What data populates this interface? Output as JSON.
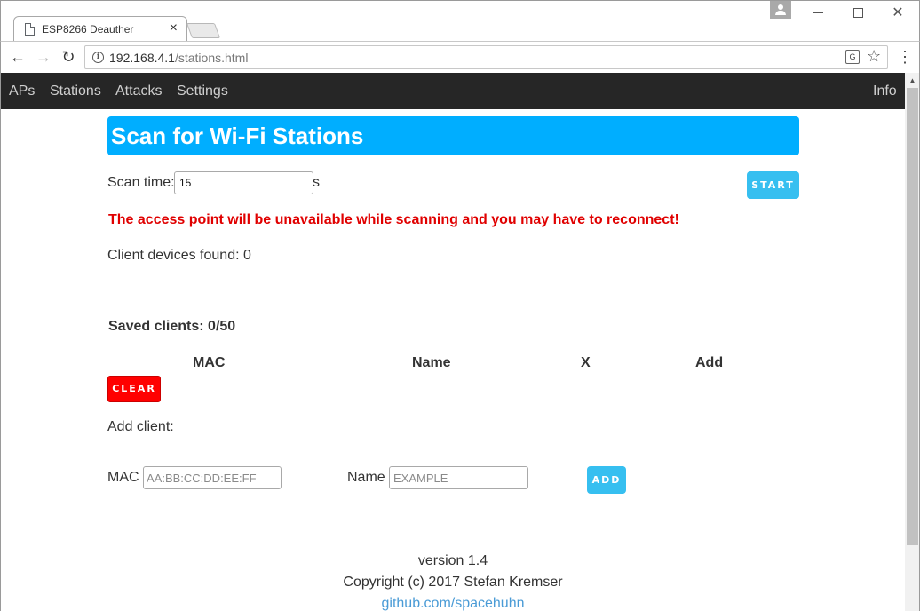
{
  "browser": {
    "tab_title": "ESP8266 Deauther",
    "url_host": "192.168.4.1",
    "url_path": "/stations.html"
  },
  "nav": {
    "items": [
      "APs",
      "Stations",
      "Attacks",
      "Settings"
    ],
    "right_item": "Info"
  },
  "page": {
    "title": "Scan for Wi-Fi Stations",
    "scan_time_label": "Scan time:",
    "scan_time_value": "15",
    "scan_time_unit": "s",
    "start_button": "START",
    "warning": "The access point will be unavailable while scanning and you may have to reconnect!",
    "client_devices_found": "Client devices found: 0",
    "saved_clients": "Saved clients: 0/50",
    "table_headers": [
      "MAC",
      "Name",
      "X",
      "Add"
    ],
    "clear_button": "CLEAR",
    "add_client_label": "Add client:",
    "mac_label": "MAC",
    "mac_placeholder": "AA:BB:CC:DD:EE:FF",
    "name_label": "Name",
    "name_placeholder": "EXAMPLE",
    "add_button": "ADD"
  },
  "footer": {
    "version": "version 1.4",
    "copyright": "Copyright (c) 2017 Stefan Kremser",
    "link": "github.com/spacehuhn"
  },
  "colors": {
    "title_bg": "#00aeff",
    "nav_bg": "#262626",
    "button_blue": "#36bff0",
    "button_red": "#ff0000",
    "warning_red": "#e00000"
  }
}
